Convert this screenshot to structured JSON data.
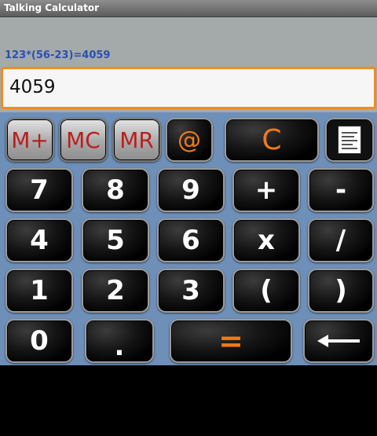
{
  "app": {
    "title": "Talking Calculator"
  },
  "display": {
    "expression": "123*(56-23)=4059",
    "result": "4059"
  },
  "keys": {
    "m_plus": "M+",
    "mc": "MC",
    "mr": "MR",
    "at": "@",
    "clear": "C",
    "seven": "7",
    "eight": "8",
    "nine": "9",
    "plus": "+",
    "minus": "-",
    "four": "4",
    "five": "5",
    "six": "6",
    "multiply": "x",
    "divide": "/",
    "one": "1",
    "two": "2",
    "three": "3",
    "open_paren": "(",
    "close_paren": ")",
    "zero": "0",
    "dot": ".",
    "equals": "="
  },
  "icons": {
    "history": "notepad-icon",
    "backspace": "backspace-arrow-icon"
  },
  "colors": {
    "accent": "#f37a16",
    "memory_text": "#bb1e1e",
    "expression_text": "#2c4fae",
    "keypad_bg": "#6e8fb7"
  }
}
